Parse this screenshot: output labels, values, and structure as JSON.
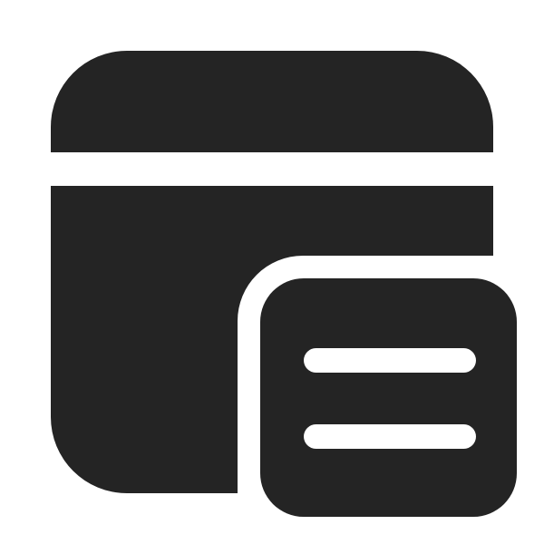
{
  "icon": {
    "name": "app-window-with-list-icon",
    "foreground": "#242424",
    "background": "#ffffff"
  }
}
